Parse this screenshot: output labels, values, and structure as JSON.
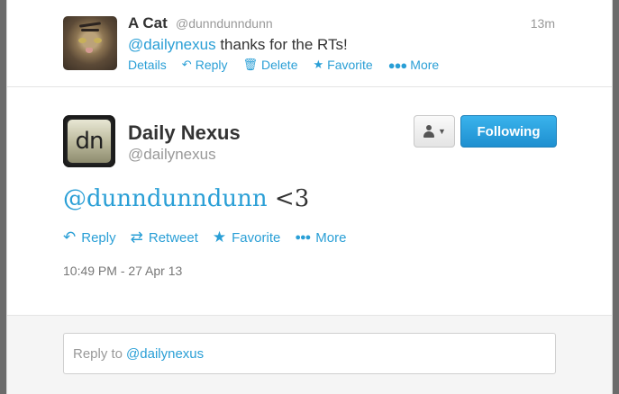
{
  "prev_tweet": {
    "name": "A Cat",
    "handle": "@dunndunndunn",
    "time": "13m",
    "mention": "@dailynexus",
    "text": "thanks for the RTs!",
    "actions": {
      "details": "Details",
      "reply": "Reply",
      "delete": "Delete",
      "favorite": "Favorite",
      "more": "More"
    }
  },
  "tweet": {
    "name": "Daily Nexus",
    "handle": "@dailynexus",
    "avatar_text": "dn",
    "follow_label": "Following",
    "mention": "@dunndunndunn",
    "text": "<3",
    "actions": {
      "reply": "Reply",
      "retweet": "Retweet",
      "favorite": "Favorite",
      "more": "More"
    },
    "timestamp": "10:49 PM - 27 Apr 13"
  },
  "reply_box": {
    "prefix": "Reply to",
    "mention": "@dailynexus"
  },
  "colors": {
    "link": "#2a9fd6",
    "follow_button": "#2a9fd6",
    "text": "#333333",
    "muted": "#999999"
  }
}
